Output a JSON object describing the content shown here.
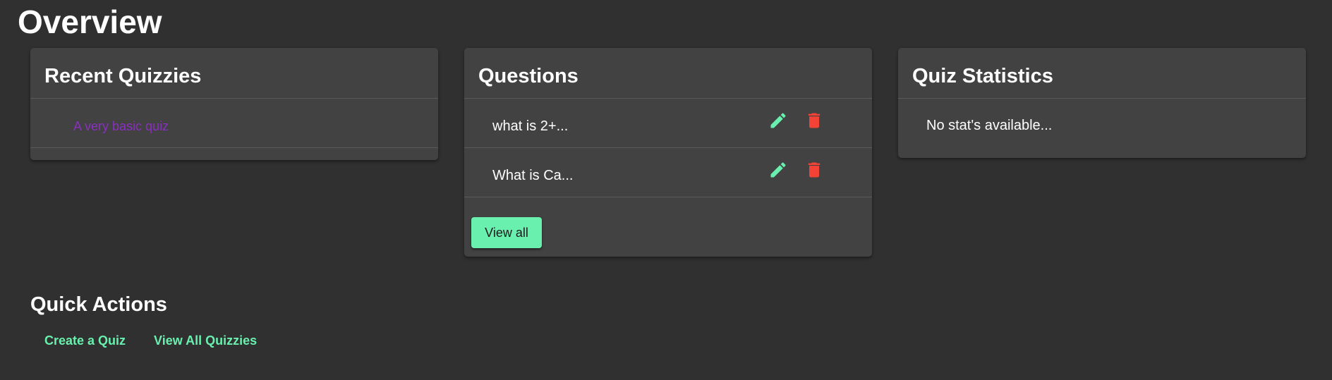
{
  "page": {
    "title": "Overview"
  },
  "recent_quizzes": {
    "title": "Recent Quizzies",
    "items": [
      {
        "label": "A very basic quiz"
      }
    ]
  },
  "questions": {
    "title": "Questions",
    "items": [
      {
        "text": "what is 2+..."
      },
      {
        "text": "What is Ca..."
      }
    ],
    "view_all_label": "View all"
  },
  "quiz_statistics": {
    "title": "Quiz Statistics",
    "empty_text": "No stat's available..."
  },
  "quick_actions": {
    "title": "Quick Actions",
    "links": [
      {
        "label": "Create a Quiz"
      },
      {
        "label": "View All Quizzies"
      }
    ]
  },
  "colors": {
    "background": "#303030",
    "card": "#424242",
    "accent": "#69f0ae",
    "danger": "#f44336",
    "quiz_link": "#8a2fbf"
  },
  "icons": {
    "edit": "pencil-icon",
    "delete": "trash-icon"
  }
}
